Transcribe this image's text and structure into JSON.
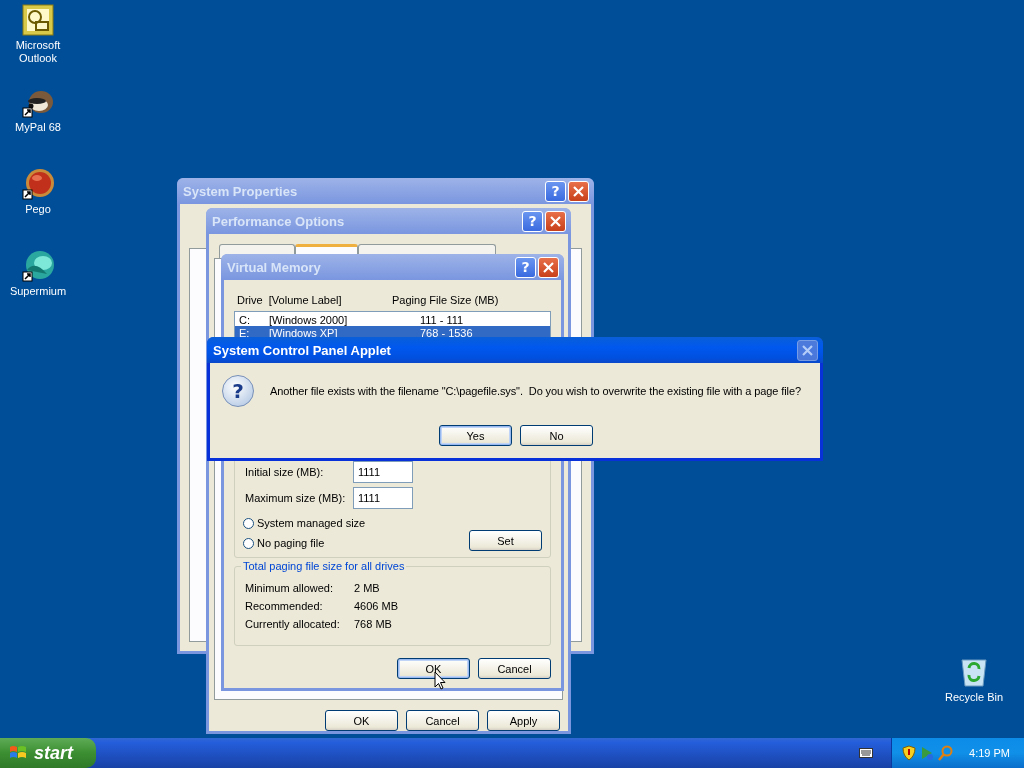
{
  "desktop_icons": [
    {
      "label": "Microsoft Outlook",
      "kind": "mail"
    },
    {
      "label": "MyPal 68",
      "kind": "raccoon"
    },
    {
      "label": "Pego",
      "kind": "orb"
    },
    {
      "label": "Supermium",
      "kind": "globe"
    }
  ],
  "recycle_bin": {
    "label": "Recycle Bin"
  },
  "system_properties": {
    "title": "System Properties",
    "active": false,
    "help": "?"
  },
  "performance_options": {
    "title": "Performance Options",
    "active": false,
    "help": "?",
    "tabs": [
      {
        "selected": false
      },
      {
        "selected": true
      },
      {
        "selected": false
      }
    ],
    "buttons": [
      {
        "label": "OK",
        "default": false
      },
      {
        "label": "Cancel",
        "default": false
      },
      {
        "label": "Apply",
        "default": false
      }
    ]
  },
  "virtual_memory": {
    "title": "Virtual Memory",
    "active": false,
    "help": "?",
    "columns": [
      "Drive  [Volume Label]",
      "Paging File Size (MB)"
    ],
    "drives": [
      {
        "drive": "C:",
        "label": "[Windows 2000]",
        "size": "111 - 111",
        "selected": false
      },
      {
        "drive": "E:",
        "label": "[Windows XP]",
        "size": "768 - 1536",
        "selected": true
      }
    ],
    "fields": [
      {
        "label": "Initial size (MB):",
        "value": "1111"
      },
      {
        "label": "Maximum size (MB):",
        "value": "1111"
      }
    ],
    "radios": [
      {
        "label": "System managed size",
        "selected": false
      },
      {
        "label": "No paging file",
        "selected": false
      }
    ],
    "set_button": "Set",
    "totals": {
      "title": "Total paging file size for all drives",
      "rows": [
        {
          "label": "Minimum allowed:",
          "value": "2 MB"
        },
        {
          "label": "Recommended:",
          "value": "4606 MB"
        },
        {
          "label": "Currently allocated:",
          "value": "768 MB"
        }
      ]
    },
    "buttons": [
      {
        "label": "OK",
        "default": true
      },
      {
        "label": "Cancel",
        "default": false
      }
    ]
  },
  "message_box": {
    "title": "System Control Panel Applet",
    "active": true,
    "close_disabled": true,
    "icon_glyph": "?",
    "message": "Another file exists with the filename \"C:\\pagefile.sys\".  Do you wish to overwrite the existing file with a page file?",
    "buttons": [
      {
        "label": "Yes",
        "default": true
      },
      {
        "label": "No",
        "default": false
      }
    ]
  },
  "taskbar": {
    "start": "start",
    "clock": "4:19 PM"
  }
}
